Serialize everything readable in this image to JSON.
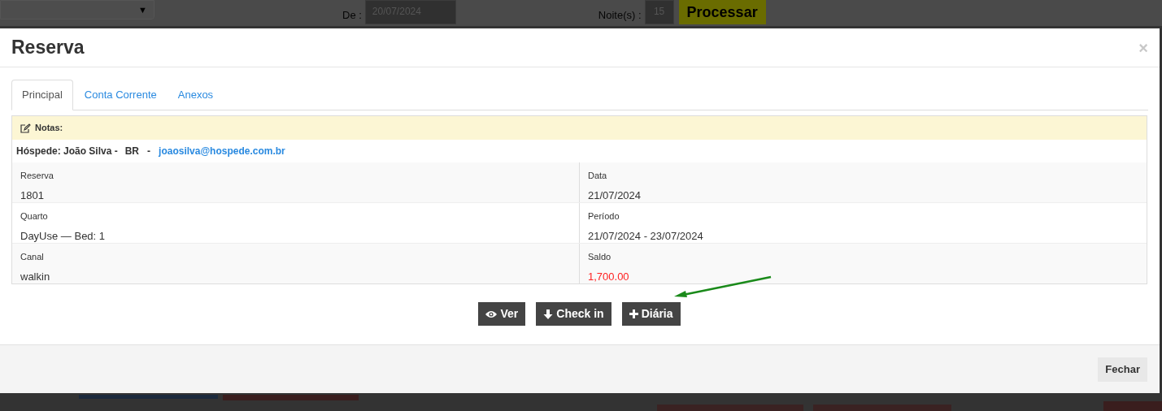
{
  "background": {
    "select_caret": "▼",
    "date_label": "De :",
    "date_value": "20/07/2024",
    "nights_label": "Noite(s) :",
    "nights_value": "15",
    "process_button": "Processar"
  },
  "modal": {
    "title": "Reserva",
    "close": "×",
    "tabs": [
      {
        "label": "Principal",
        "selected": true
      },
      {
        "label": "Conta Corrente",
        "selected": false
      },
      {
        "label": "Anexos",
        "selected": false
      }
    ],
    "notes_label": "Notas:",
    "guest": {
      "label": "Hóspede: João Silva -",
      "country": "BR",
      "separator": "-",
      "email": "joaosilva@hospede.com.br"
    },
    "rows": [
      {
        "cells": [
          {
            "label": "Reserva",
            "value": "1801",
            "highlight": false
          },
          {
            "label": "Data",
            "value": "21/07/2024",
            "highlight": false
          }
        ]
      },
      {
        "cells": [
          {
            "label": "Quarto",
            "value": "DayUse — Bed: 1",
            "highlight": false
          },
          {
            "label": "Período",
            "value": "21/07/2024 - 23/07/2024",
            "highlight": false
          }
        ]
      },
      {
        "cells": [
          {
            "label": "Canal",
            "value": "walkin",
            "highlight": false
          },
          {
            "label": "Saldo",
            "value": "1,700.00",
            "highlight": true
          }
        ]
      }
    ],
    "buttons": [
      {
        "kind": "eye",
        "label": "Ver"
      },
      {
        "kind": "down",
        "label": "Check in"
      },
      {
        "kind": "plus",
        "label": "Diária"
      }
    ],
    "footer_button": "Fechar"
  }
}
